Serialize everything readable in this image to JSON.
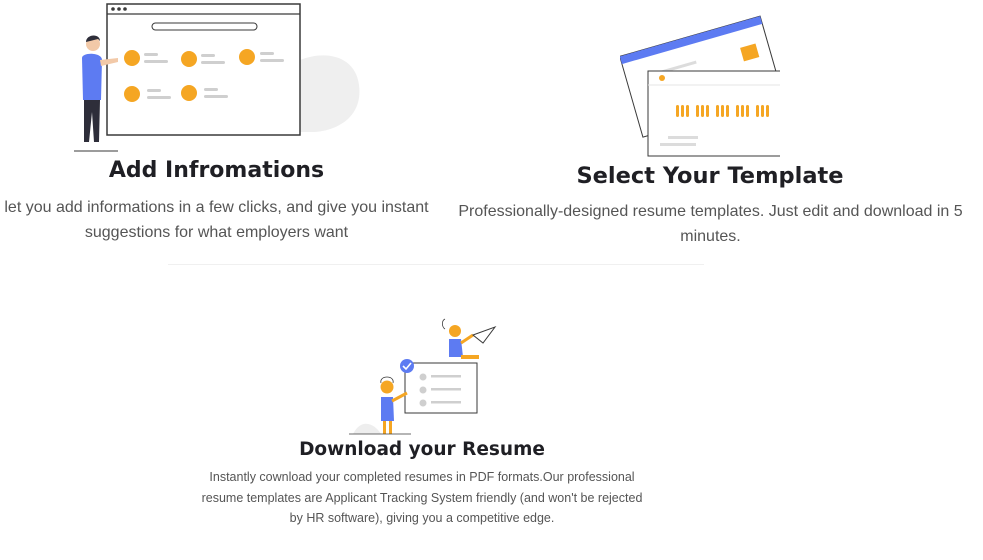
{
  "features": [
    {
      "title": "Add Infromations",
      "description": "let you add informations in a few clicks, and give you instant suggestions for what employers want",
      "illustration": "person-with-browser-window-illustration"
    },
    {
      "title": "Select Your Template",
      "description": "Professionally-designed resume templates. Just edit and download in 5 minutes.",
      "illustration": "resume-template-cards-illustration"
    },
    {
      "title": "Download your Resume",
      "description": "Instantly cownload your completed resumes in PDF formats.Our professional resume templates are Applicant Tracking System friendly (and won't be rejected by HR software), giving you a competitive edge.",
      "illustration": "people-with-checklist-and-paper-plane-illustration"
    }
  ],
  "colors": {
    "accent": "#f5a623",
    "blue": "#5d7bf2",
    "dark": "#1f1f24",
    "text": "#555555"
  }
}
